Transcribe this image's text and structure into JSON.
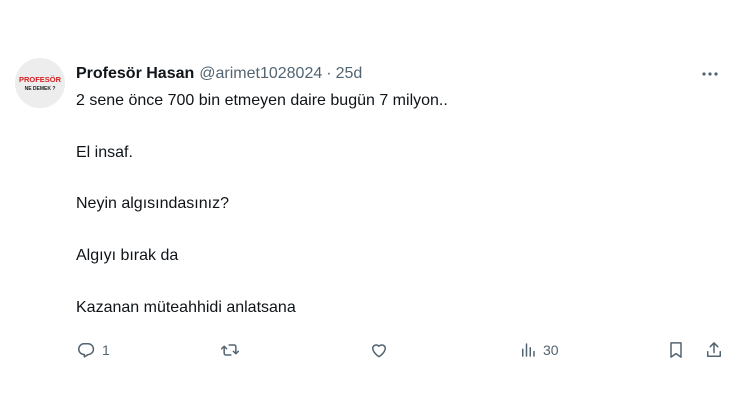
{
  "author": {
    "display_name": "Profesör Hasan",
    "handle": "@arimet1028024",
    "separator": "·",
    "time_ago": "25d",
    "avatar_text_top": "PROFESÖR",
    "avatar_text_bottom": "NE DEMEK ?",
    "avatar_icon": "avatar-logo"
  },
  "tweet": {
    "lines": [
      "2 sene önce 700 bin etmeyen daire bugün 7 milyon..",
      "El insaf.",
      "Neyin algısındasınız?",
      "Algıyı bırak da",
      "Kazanan müteahhidi anlatsana"
    ]
  },
  "actions": {
    "reply": {
      "icon": "reply-icon",
      "count": "1"
    },
    "retweet": {
      "icon": "retweet-icon",
      "count": ""
    },
    "like": {
      "icon": "heart-icon",
      "count": ""
    },
    "views": {
      "icon": "views-icon",
      "count": "30"
    },
    "bookmark": {
      "icon": "bookmark-icon"
    },
    "share": {
      "icon": "share-icon"
    }
  },
  "more_icon": "more-icon",
  "colors": {
    "text": "#0f1419",
    "secondary": "#536471",
    "avatar_red": "#d62020",
    "background": "#ffffff"
  }
}
